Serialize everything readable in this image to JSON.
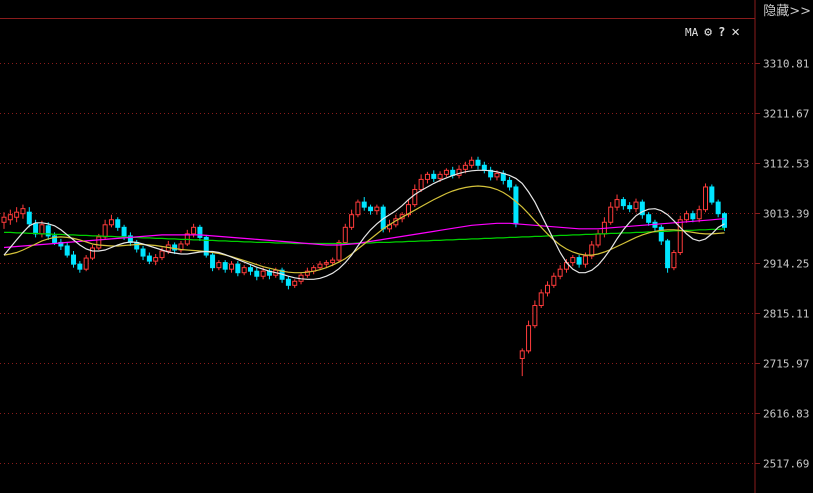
{
  "header": {
    "hide_label": "隐藏>>"
  },
  "toolbar": {
    "ma_label": "MA",
    "settings_icon": "⚙",
    "help_icon": "?",
    "close_icon": "✕"
  },
  "colors": {
    "up": "#ff3b3b",
    "down": "#00e5ff",
    "grid": "#8a1c1c",
    "ma5": "#e6e6e6",
    "ma10": "#d4c23a",
    "ma20": "#ff00ff",
    "ma60": "#00d000"
  },
  "chart_data": {
    "type": "candlestick",
    "y_ticks": [
      "3310.81",
      "3211.67",
      "3112.53",
      "3013.39",
      "2914.25",
      "2815.11",
      "2715.97",
      "2616.83",
      "2517.69"
    ],
    "ylim": [
      2517.69,
      3310.81
    ],
    "candles": [
      [
        2995,
        3005,
        2982,
        3015
      ],
      [
        3000,
        3010,
        2990,
        3020
      ],
      [
        3005,
        3015,
        2995,
        3025
      ],
      [
        3012,
        3022,
        3002,
        3030
      ],
      [
        3015,
        2992,
        2985,
        3025
      ],
      [
        2992,
        2972,
        2965,
        3000
      ],
      [
        2972,
        2990,
        2965,
        2998
      ],
      [
        2988,
        2968,
        2960,
        2995
      ],
      [
        2968,
        2955,
        2950,
        2975
      ],
      [
        2955,
        2948,
        2940,
        2962
      ],
      [
        2948,
        2930,
        2925,
        2955
      ],
      [
        2930,
        2912,
        2905,
        2938
      ],
      [
        2912,
        2902,
        2895,
        2918
      ],
      [
        2902,
        2924,
        2898,
        2930
      ],
      [
        2924,
        2944,
        2920,
        2950
      ],
      [
        2944,
        2966,
        2940,
        2972
      ],
      [
        2966,
        2990,
        2962,
        3000
      ],
      [
        2990,
        3000,
        2985,
        3010
      ],
      [
        3000,
        2985,
        2978,
        3005
      ],
      [
        2985,
        2968,
        2960,
        2990
      ],
      [
        2968,
        2955,
        2948,
        2975
      ],
      [
        2955,
        2942,
        2935,
        2960
      ],
      [
        2942,
        2928,
        2920,
        2948
      ],
      [
        2928,
        2918,
        2912,
        2935
      ],
      [
        2918,
        2925,
        2910,
        2932
      ],
      [
        2925,
        2938,
        2920,
        2945
      ],
      [
        2938,
        2950,
        2932,
        2958
      ],
      [
        2950,
        2940,
        2932,
        2955
      ],
      [
        2940,
        2952,
        2935,
        2958
      ],
      [
        2952,
        2972,
        2948,
        2980
      ],
      [
        2972,
        2985,
        2965,
        2992
      ],
      [
        2985,
        2965,
        2958,
        2990
      ],
      [
        2965,
        2930,
        2925,
        2970
      ],
      [
        2930,
        2905,
        2898,
        2935
      ],
      [
        2905,
        2915,
        2900,
        2920
      ],
      [
        2915,
        2902,
        2895,
        2920
      ],
      [
        2902,
        2912,
        2895,
        2918
      ],
      [
        2912,
        2895,
        2888,
        2918
      ],
      [
        2895,
        2905,
        2890,
        2910
      ],
      [
        2905,
        2898,
        2890,
        2910
      ],
      [
        2898,
        2888,
        2880,
        2905
      ],
      [
        2888,
        2898,
        2882,
        2905
      ],
      [
        2898,
        2890,
        2882,
        2902
      ],
      [
        2890,
        2900,
        2885,
        2905
      ],
      [
        2900,
        2882,
        2875,
        2905
      ],
      [
        2882,
        2870,
        2862,
        2888
      ],
      [
        2870,
        2878,
        2865,
        2882
      ],
      [
        2878,
        2890,
        2872,
        2895
      ],
      [
        2890,
        2898,
        2885,
        2905
      ],
      [
        2898,
        2905,
        2892,
        2910
      ],
      [
        2905,
        2912,
        2900,
        2918
      ],
      [
        2912,
        2915,
        2905,
        2920
      ],
      [
        2915,
        2920,
        2908,
        2925
      ],
      [
        2920,
        2955,
        2915,
        2960
      ],
      [
        2955,
        2985,
        2950,
        2992
      ],
      [
        2985,
        3010,
        2980,
        3020
      ],
      [
        3010,
        3035,
        3005,
        3040
      ],
      [
        3035,
        3025,
        3018,
        3045
      ],
      [
        3025,
        3018,
        3010,
        3030
      ],
      [
        3018,
        3025,
        3010,
        3030
      ],
      [
        3025,
        2982,
        2975,
        3030
      ],
      [
        2982,
        2990,
        2975,
        3000
      ],
      [
        2990,
        3002,
        2985,
        3010
      ],
      [
        3002,
        3010,
        2995,
        3015
      ],
      [
        3010,
        3030,
        3005,
        3040
      ],
      [
        3030,
        3060,
        3025,
        3070
      ],
      [
        3060,
        3080,
        3055,
        3090
      ],
      [
        3080,
        3090,
        3072,
        3095
      ],
      [
        3090,
        3082,
        3075,
        3098
      ],
      [
        3082,
        3090,
        3075,
        3096
      ],
      [
        3090,
        3098,
        3085,
        3102
      ],
      [
        3098,
        3088,
        3082,
        3105
      ],
      [
        3088,
        3100,
        3082,
        3108
      ],
      [
        3100,
        3108,
        3092,
        3115
      ],
      [
        3108,
        3118,
        3102,
        3125
      ],
      [
        3118,
        3108,
        3100,
        3125
      ],
      [
        3108,
        3098,
        3092,
        3115
      ],
      [
        3098,
        3085,
        3078,
        3105
      ],
      [
        3085,
        3092,
        3078,
        3098
      ],
      [
        3092,
        3078,
        3070,
        3098
      ],
      [
        3078,
        3065,
        3058,
        3085
      ],
      [
        3065,
        2992,
        2985,
        3070
      ],
      [
        2725,
        2740,
        2690,
        2745
      ],
      [
        2740,
        2790,
        2735,
        2800
      ],
      [
        2790,
        2830,
        2785,
        2840
      ],
      [
        2830,
        2855,
        2825,
        2862
      ],
      [
        2855,
        2870,
        2848,
        2878
      ],
      [
        2870,
        2888,
        2865,
        2895
      ],
      [
        2888,
        2902,
        2882,
        2910
      ],
      [
        2902,
        2915,
        2895,
        2922
      ],
      [
        2915,
        2925,
        2908,
        2930
      ],
      [
        2925,
        2912,
        2905,
        2930
      ],
      [
        2912,
        2928,
        2905,
        2935
      ],
      [
        2928,
        2950,
        2922,
        2958
      ],
      [
        2950,
        2972,
        2945,
        2980
      ],
      [
        2972,
        2995,
        2965,
        3005
      ],
      [
        2995,
        3025,
        2990,
        3035
      ],
      [
        3025,
        3040,
        3018,
        3050
      ],
      [
        3040,
        3028,
        3020,
        3045
      ],
      [
        3028,
        3022,
        3015,
        3035
      ],
      [
        3022,
        3035,
        3015,
        3042
      ],
      [
        3035,
        3010,
        3002,
        3040
      ],
      [
        3010,
        2995,
        2988,
        3015
      ],
      [
        2995,
        2985,
        2978,
        3000
      ],
      [
        2985,
        2958,
        2950,
        2990
      ],
      [
        2958,
        2905,
        2895,
        2962
      ],
      [
        2905,
        2935,
        2900,
        2940
      ],
      [
        2935,
        3000,
        2930,
        3008
      ],
      [
        3000,
        3012,
        2994,
        3018
      ],
      [
        3012,
        3002,
        2995,
        3018
      ],
      [
        3002,
        3020,
        2995,
        3028
      ],
      [
        3020,
        3065,
        3015,
        3072
      ],
      [
        3065,
        3035,
        3030,
        3070
      ],
      [
        3035,
        3012,
        3005,
        3040
      ],
      [
        3012,
        2985,
        2978,
        3015
      ]
    ],
    "ma5": [
      2930,
      2945,
      2960,
      2975,
      2988,
      2994,
      2994,
      2992,
      2988,
      2980,
      2970,
      2960,
      2950,
      2942,
      2938,
      2938,
      2940,
      2945,
      2950,
      2954,
      2956,
      2955,
      2952,
      2948,
      2944,
      2940,
      2936,
      2934,
      2932,
      2932,
      2934,
      2936,
      2937,
      2937,
      2935,
      2931,
      2926,
      2921,
      2916,
      2911,
      2906,
      2902,
      2898,
      2895,
      2892,
      2888,
      2885,
      2883,
      2882,
      2882,
      2884,
      2888,
      2894,
      2903,
      2915,
      2930,
      2948,
      2965,
      2980,
      2992,
      3002,
      3010,
      3018,
      3028,
      3040,
      3050,
      3058,
      3065,
      3072,
      3078,
      3083,
      3088,
      3092,
      3095,
      3097,
      3098,
      3098,
      3097,
      3095,
      3092,
      3088,
      3082,
      3072,
      3055,
      3035,
      3010,
      2985,
      2960,
      2935,
      2915,
      2902,
      2895,
      2895,
      2900,
      2910,
      2925,
      2942,
      2962,
      2980,
      2995,
      3008,
      3016,
      3021,
      3022,
      3018,
      3010,
      2998,
      2985,
      2972,
      2962,
      2958,
      2962,
      2972,
      2985,
      2992
    ],
    "ma10": [
      2930,
      2932,
      2935,
      2940,
      2946,
      2952,
      2958,
      2962,
      2965,
      2966,
      2965,
      2963,
      2960,
      2956,
      2952,
      2950,
      2949,
      2948,
      2948,
      2949,
      2950,
      2951,
      2951,
      2950,
      2949,
      2947,
      2945,
      2943,
      2941,
      2940,
      2939,
      2938,
      2937,
      2935,
      2933,
      2930,
      2927,
      2923,
      2919,
      2915,
      2911,
      2907,
      2904,
      2901,
      2898,
      2896,
      2895,
      2895,
      2896,
      2898,
      2901,
      2905,
      2910,
      2916,
      2923,
      2932,
      2942,
      2952,
      2962,
      2972,
      2982,
      2990,
      2998,
      3005,
      3012,
      3019,
      3026,
      3033,
      3040,
      3046,
      3052,
      3057,
      3061,
      3064,
      3066,
      3067,
      3066,
      3064,
      3060,
      3054,
      3046,
      3036,
      3025,
      3012,
      2998,
      2985,
      2972,
      2960,
      2950,
      2942,
      2936,
      2932,
      2930,
      2930,
      2932,
      2936,
      2941,
      2947,
      2953,
      2959,
      2965,
      2970,
      2974,
      2977,
      2979,
      2980,
      2980,
      2979,
      2977,
      2975,
      2973,
      2972,
      2972,
      2973,
      2974
    ],
    "ma20": [
      2945,
      2946,
      2947,
      2948,
      2949,
      2950,
      2951,
      2952,
      2953,
      2954,
      2955,
      2956,
      2957,
      2958,
      2959,
      2960,
      2961,
      2962,
      2963,
      2964,
      2965,
      2966,
      2967,
      2968,
      2969,
      2970,
      2970,
      2970,
      2970,
      2970,
      2970,
      2970,
      2969,
      2968,
      2967,
      2966,
      2965,
      2964,
      2963,
      2962,
      2961,
      2960,
      2959,
      2958,
      2957,
      2956,
      2955,
      2954,
      2953,
      2952,
      2951,
      2950,
      2950,
      2950,
      2951,
      2952,
      2953,
      2955,
      2957,
      2959,
      2961,
      2963,
      2965,
      2967,
      2969,
      2971,
      2973,
      2975,
      2977,
      2979,
      2981,
      2983,
      2985,
      2987,
      2989,
      2990,
      2991,
      2992,
      2993,
      2993,
      2993,
      2992,
      2991,
      2990,
      2989,
      2988,
      2987,
      2986,
      2985,
      2984,
      2983,
      2982,
      2982,
      2982,
      2982,
      2983,
      2984,
      2985,
      2986,
      2987,
      2988,
      2989,
      2990,
      2991,
      2992,
      2993,
      2994,
      2995,
      2996,
      2997,
      2998,
      2999,
      3000,
      3001,
      3002
    ],
    "ma60": [
      2975,
      2975,
      2974,
      2974,
      2973,
      2973,
      2972,
      2972,
      2971,
      2971,
      2970,
      2970,
      2969,
      2969,
      2968,
      2968,
      2967,
      2967,
      2966,
      2966,
      2965,
      2965,
      2964,
      2964,
      2963,
      2963,
      2962,
      2962,
      2961,
      2961,
      2960,
      2960,
      2959,
      2959,
      2958,
      2958,
      2957,
      2957,
      2956,
      2956,
      2955,
      2955,
      2955,
      2954,
      2954,
      2954,
      2953,
      2953,
      2953,
      2953,
      2953,
      2953,
      2953,
      2953,
      2953,
      2953,
      2954,
      2954,
      2954,
      2955,
      2955,
      2955,
      2956,
      2956,
      2957,
      2957,
      2958,
      2958,
      2959,
      2959,
      2960,
      2960,
      2961,
      2961,
      2962,
      2962,
      2963,
      2963,
      2964,
      2964,
      2965,
      2965,
      2966,
      2966,
      2967,
      2967,
      2968,
      2968,
      2969,
      2969,
      2970,
      2970,
      2971,
      2971,
      2972,
      2972,
      2973,
      2973,
      2974,
      2974,
      2975,
      2975,
      2976,
      2976,
      2977,
      2977,
      2978,
      2978,
      2979,
      2979,
      2980,
      2980,
      2981,
      2981,
      2982
    ]
  }
}
